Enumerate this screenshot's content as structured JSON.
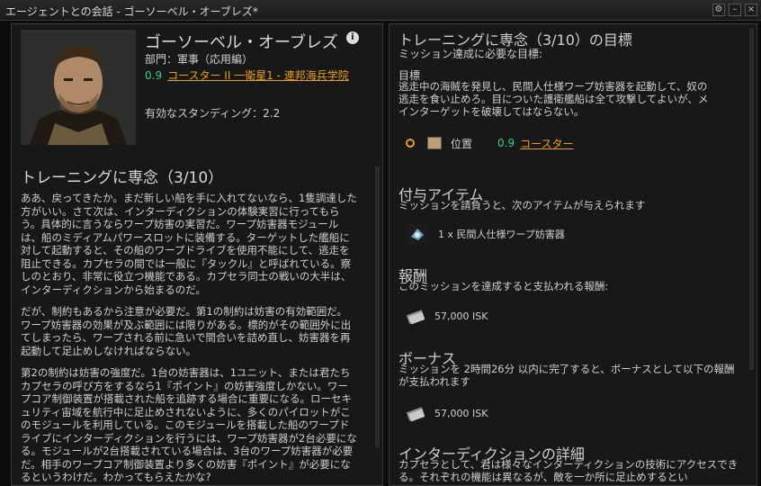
{
  "window": {
    "title": "エージェントとの会話 - ゴーソーベル・オーブレズ*"
  },
  "agent": {
    "name": "ゴーソーベル・オーブレズ",
    "division": "部門：軍事（応用編）",
    "security": "0.9",
    "location_link": "コースター II 一衛星1 - 連邦海兵学院",
    "standing": "有効なスタンディング：2.2"
  },
  "mission": {
    "title": "トレーニングに専念（3/10）",
    "paragraphs": [
      "ああ、戻ってきたか。まだ新しい船を手に入れてないなら、1隻調達した方がいい。さて次は、インターディクションの体験実習に行ってもらう。具体的に言うならワープ妨害の実習だ。ワープ妨害器モジュールは、船のミディアムパワースロットに装備する。ターゲットした艦船に対して起動すると、その船のワープドライブを使用不能にして、逃走を阻止できる。カプセラの間では一般に『タックル』と呼ばれている。察しのとおり、非常に役立つ機能である。カプセラ同士の戦いの大半は、インターディクションから始まるのだ。",
      "だが、制約もあるから注意が必要だ。第1の制約は妨害の有効範囲だ。ワープ妨害器の効果が及ぶ範囲には限りがある。標的がその範囲外に出てしまったら、ワープされる前に急いで間合いを詰め直し、妨害器を再起動して足止めしなければならない。",
      "第2の制約は妨害の強度だ。1台の妨害器は、1ユニット、または君たち カプセラの呼び方をするなら1『ポイント』の妨害強度しかない。ワープコア制御装置が搭載された船を追跡する場合に重要になる。ローセキュリティ宙域を航行中に足止めされないように、多くのパイロットがこのモジュールを利用している。このモジュールを搭載した船のワープドライブにインターディクションを行うには、ワープ妨害器が2台必要になる。モジュールが2台搭載されている場合は、3台のワープ妨害器が必要だ。相手のワープコア制御装置より多くの妨害『ポイント』が必要になるというわけだ。わかってもらえたかな?"
    ]
  },
  "objectives": {
    "title": "トレーニングに専念（3/10）の目標",
    "subtitle": "ミッション達成に必要な目標:",
    "objective_label": "目標",
    "objective_text": "逃走中の海賊を発見し、民間人仕様ワープ妨害器を起動して、奴の逃走を食い止めろ。目についた護衛艦船は全て攻撃してよいが、メインターゲットを破壊してはならない。",
    "location_label": "位置",
    "location_security": "0.9",
    "location_link": "コースター"
  },
  "granted": {
    "title": "付与アイテム",
    "desc": "ミッションを請負うと、次のアイテムが与えられます",
    "item": "1 x 民間人仕様ワープ妨害器"
  },
  "reward": {
    "title": "報酬",
    "desc": "このミッションを達成すると支払われる報酬:",
    "amount": "57,000 ISK"
  },
  "bonus": {
    "title": "ボーナス",
    "desc": "ミッションを 2時間26分 以内に完了すると、ボーナスとして以下の報酬が支払われます",
    "amount": "57,000 ISK"
  },
  "interdiction": {
    "title": "インターディクションの詳細",
    "desc": "カプセラとして、君は様々なインターディクションの技術にアクセスできる。それぞれの機能は異なるが、敵を一か所に足止めするとい"
  },
  "colors": {
    "security": "#35d07f",
    "link": "#e8a020"
  },
  "icons": [
    "info-icon",
    "location-icon",
    "warp-disruptor-icon",
    "isk-icon"
  ]
}
